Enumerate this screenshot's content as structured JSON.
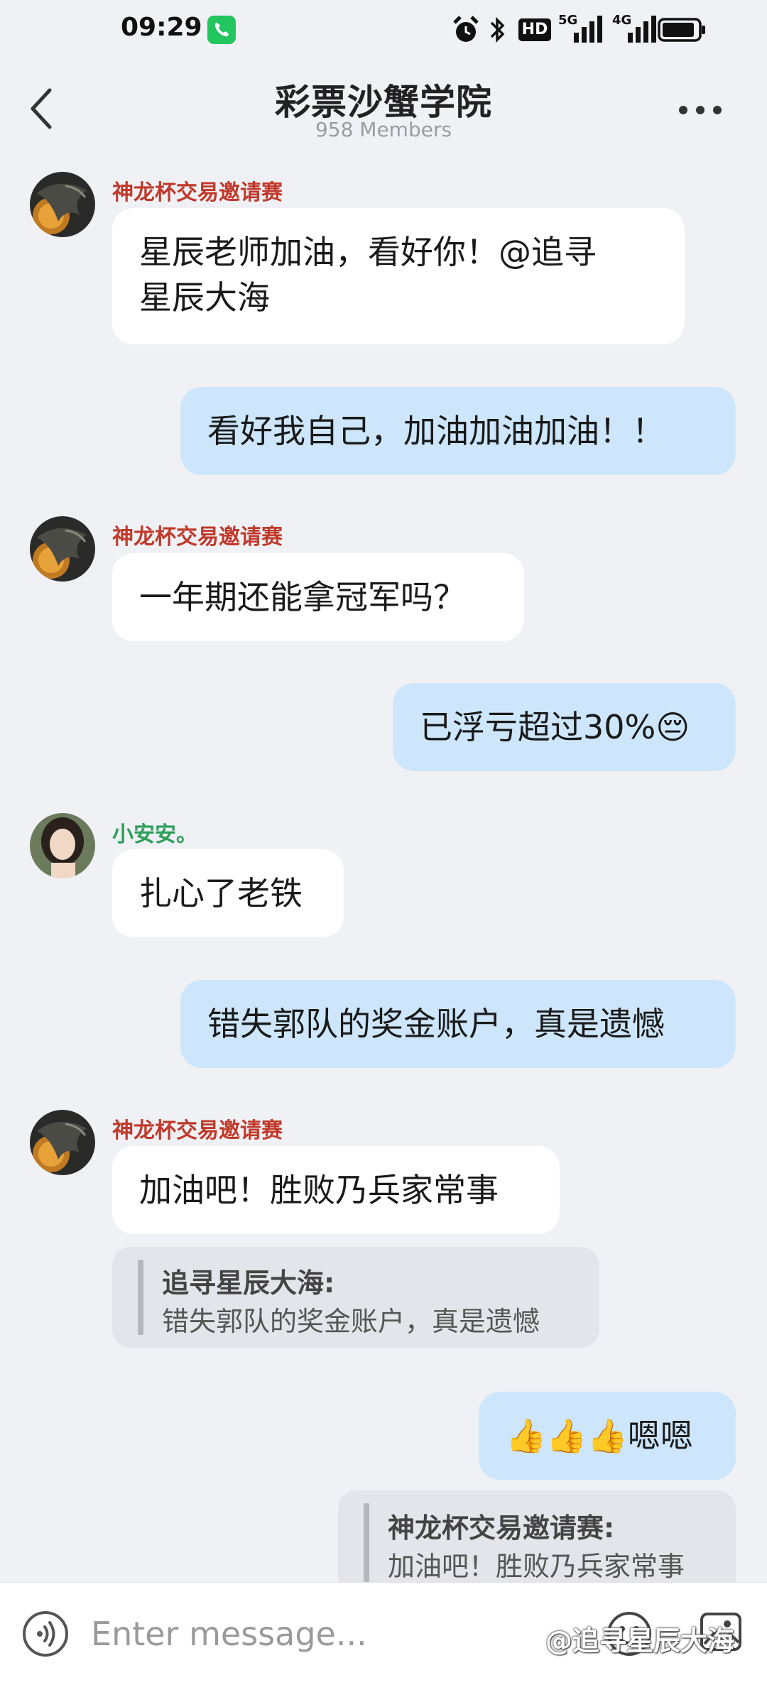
{
  "status_bar": {
    "time": "09:29",
    "icons": [
      "phone-call-badge",
      "alarm-icon",
      "bluetooth-icon",
      "hd-volte-icon",
      "5g-signal-icon",
      "4g-signal-icon",
      "battery-icon"
    ],
    "hd_label": "HD",
    "net1_label": "5G",
    "net2_label": "4G"
  },
  "header": {
    "title": "彩票沙蟹学院",
    "subtitle": "958 Members"
  },
  "colors": {
    "sender_red": "#c0392b",
    "sender_green": "#2e9d5b",
    "outgoing_bubble": "#cde6fb",
    "incoming_bubble": "#ffffff",
    "background": "#f0f1f5"
  },
  "messages": [
    {
      "direction": "in",
      "sender": "神龙杯交易邀请赛",
      "line1": "星辰老师加油，看好你！@追寻",
      "line2": "星辰大海"
    },
    {
      "direction": "out",
      "text": "看好我自己，加油加油加油！！"
    },
    {
      "direction": "in",
      "sender": "神龙杯交易邀请赛",
      "text": "一年期还能拿冠军吗？"
    },
    {
      "direction": "out",
      "text": "已浮亏超过30%",
      "emoji": "😔"
    },
    {
      "direction": "in",
      "sender": "小安安。",
      "text": "扎心了老铁"
    },
    {
      "direction": "out",
      "text": "错失郭队的奖金账户，真是遗憾"
    },
    {
      "direction": "in",
      "sender": "神龙杯交易邀请赛",
      "text": "加油吧！胜败乃兵家常事",
      "quote": {
        "author": "追寻星辰大海:",
        "text": "错失郭队的奖金账户，真是遗憾"
      }
    },
    {
      "direction": "out",
      "emoji": "👍👍👍",
      "text": "嗯嗯",
      "quote": {
        "author": "神龙杯交易邀请赛:",
        "text": "加油吧！胜败乃兵家常事"
      }
    }
  ],
  "input": {
    "placeholder": "Enter message..."
  },
  "watermark": "@追寻星辰大海"
}
